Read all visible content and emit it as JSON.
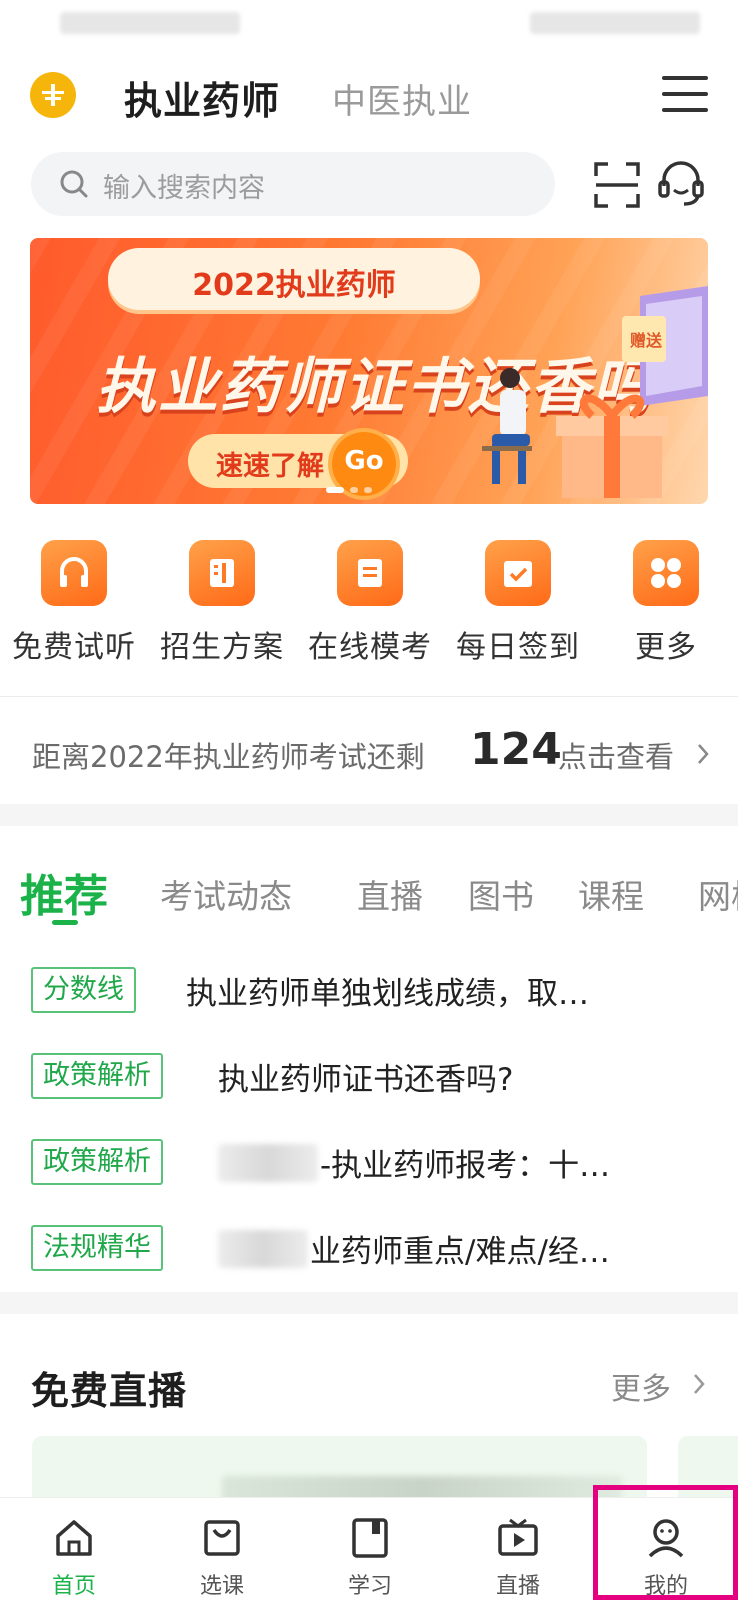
{
  "header": {
    "title": "执业药师",
    "subtitle": "中医执业"
  },
  "search": {
    "placeholder": "输入搜索内容"
  },
  "banner": {
    "pill_text": "2022执业药师",
    "headline": "执业药师证书还香吗",
    "cta": "速速了解",
    "go": "Go",
    "gift_tag": "赠送",
    "slide_index": 1,
    "slide_count": 3
  },
  "quick_actions": [
    {
      "label": "免费试听",
      "icon": "headphones-icon"
    },
    {
      "label": "招生方案",
      "icon": "book-icon"
    },
    {
      "label": "在线模考",
      "icon": "document-icon"
    },
    {
      "label": "每日签到",
      "icon": "calendar-check-icon"
    },
    {
      "label": "更多",
      "icon": "grid-icon"
    }
  ],
  "countdown": {
    "text": "距离2022年执业药师考试还剩",
    "days": "124",
    "link": "点击查看"
  },
  "tabs": [
    "推荐",
    "考试动态",
    "直播",
    "图书",
    "课程",
    "网校"
  ],
  "news": [
    {
      "tag": "分数线",
      "title": "执业药师单独划线成绩，取…"
    },
    {
      "tag": "政策解析",
      "title": "执业药师证书还香吗?"
    },
    {
      "tag": "政策解析",
      "title": "-执业药师报考：十…"
    },
    {
      "tag": "法规精华",
      "title": "业药师重点/难点/经…"
    }
  ],
  "live_section": {
    "title": "免费直播",
    "more": "更多"
  },
  "tabbar": [
    {
      "label": "首页",
      "icon": "home-icon",
      "active": true
    },
    {
      "label": "选课",
      "icon": "bag-icon",
      "active": false
    },
    {
      "label": "学习",
      "icon": "notebook-icon",
      "active": false
    },
    {
      "label": "直播",
      "icon": "tv-play-icon",
      "active": false
    },
    {
      "label": "我的",
      "icon": "user-icon",
      "active": false
    }
  ],
  "colors": {
    "accent_green": "#1bb24a",
    "orange": "#ff6a17",
    "highlight_magenta": "#e5007f",
    "logo_yellow": "#f5b50a"
  }
}
